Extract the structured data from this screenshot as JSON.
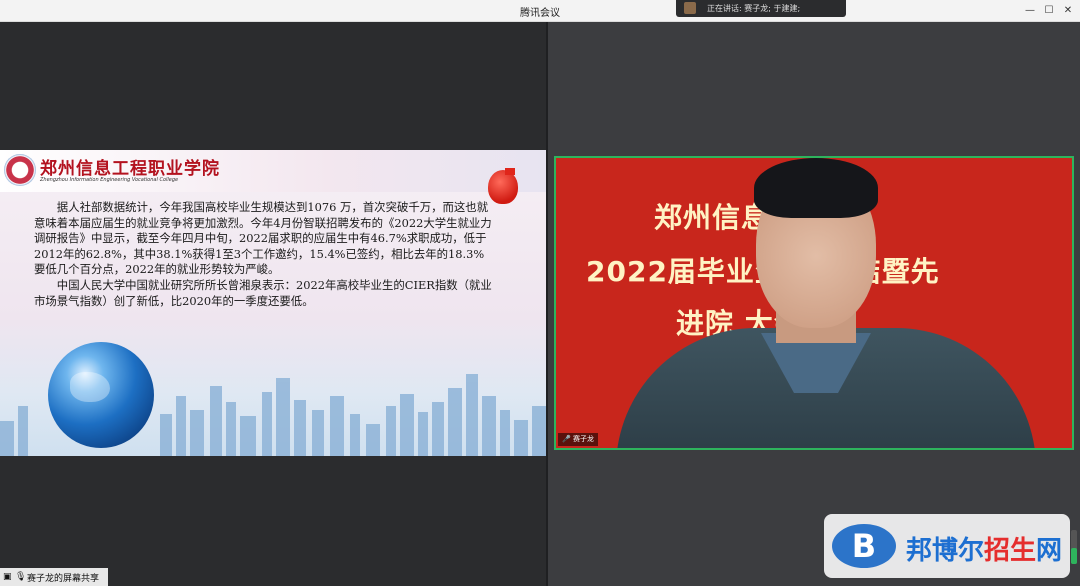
{
  "window": {
    "title": "腾讯会议",
    "minimize_icon": "—",
    "maximize_icon": "☐",
    "close_icon": "✕"
  },
  "speaking_indicator": {
    "text": "正在讲话: 赛子龙; 于建建;"
  },
  "slide": {
    "school_name": "郑州信息工程职业学院",
    "school_name_en": "Zhengzhou Information Engineering Vocational College",
    "paragraph1": "据人社部数据统计，今年我国高校毕业生规模达到1076 万，首次突破千万，而这也就意味着本届应届生的就业竞争将更加激烈。今年4月份智联招聘发布的《2022大学生就业力调研报告》中显示，截至今年四月中旬，2022届求职的应届生中有46.7%求职成功，低于2012年的62.8%，其中38.1%获得1至3个工作邀约，15.4%已签约，相比去年的18.3%要低几个百分点，2022年的就业形势较为严峻。",
    "paragraph2": "中国人民大学中国就业研究所所长曾湘泉表示：2022年高校毕业生的CIER指数（就业市场景气指数）创了新低，比2020年的一季度还要低。"
  },
  "camera": {
    "banner_line1": "郑州信息        业学院",
    "banner_line2": "2022届毕业生      作总结暨先",
    "banner_line3": "进院        大会",
    "participant_label": "赛子龙"
  },
  "watermark": {
    "logo_letter": "B",
    "text_a": "邦博尔",
    "text_b": "招生",
    "text_c": "网"
  },
  "share_bar": {
    "label": "赛子龙的屏幕共享"
  }
}
